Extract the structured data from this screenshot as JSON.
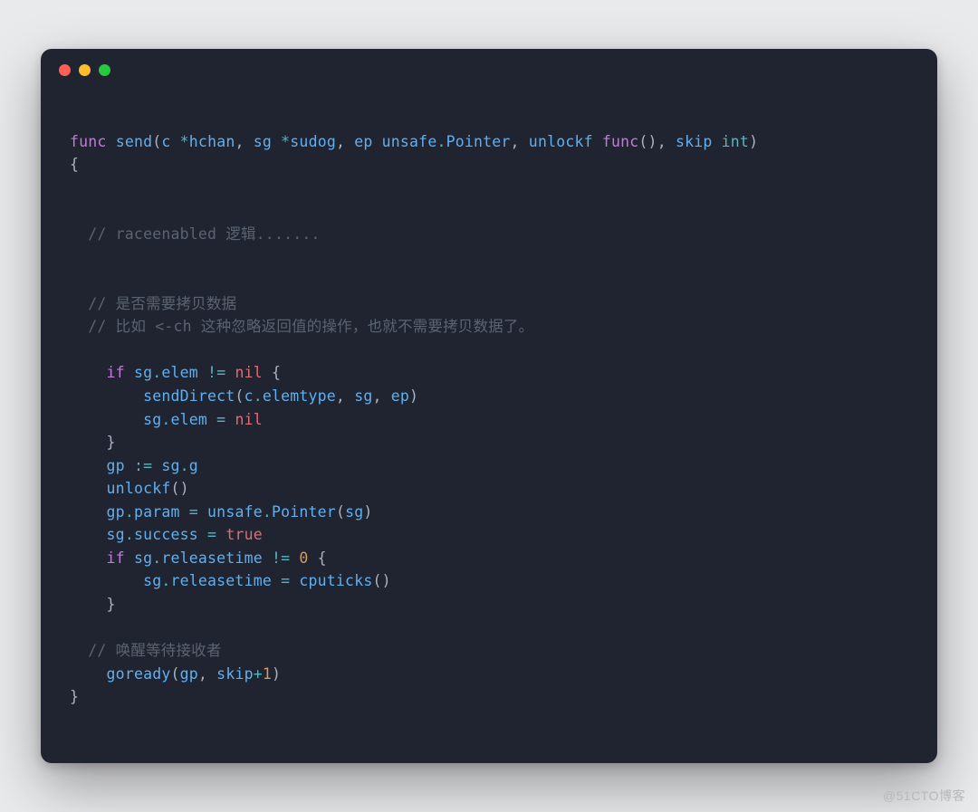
{
  "watermark": "@51CTO博客",
  "code": {
    "l1": {
      "kw1": "func",
      "fn": "send",
      "p1": "(",
      "id1": "c",
      "op1": " *",
      "id2": "hchan",
      "p2": ",",
      "id3": " sg",
      "op2": " *",
      "id4": "sudog",
      "p3": ",",
      "id5": " ep",
      "id6": " unsafe",
      "op3": ".",
      "id7": "Pointer",
      "p4": ",",
      "id8": " unlockf",
      "kw2": " func",
      "p5": "()",
      "p6": ",",
      "id9": " skip",
      "ty1": " int",
      "p7": ") "
    },
    "l2": {
      "p": "{"
    },
    "l3": {
      "txt": "  // raceenabled 逻辑......."
    },
    "l4": {
      "txt": "  // 是否需要拷贝数据"
    },
    "l5": {
      "txt": "  // 比如 <-ch 这种忽略返回值的操作，也就不需要拷贝数据了。"
    },
    "l6": {
      "kw": "if",
      "id1": " sg",
      "op1": ".",
      "id2": "elem",
      "op2": " != ",
      "nil": "nil",
      "p": " {"
    },
    "l7": {
      "fn": "sendDirect",
      "p1": "(",
      "id1": "c",
      "op1": ".",
      "id2": "elemtype",
      "p2": ",",
      "id3": " sg",
      "p3": ",",
      "id4": " ep",
      "p4": ")"
    },
    "l8": {
      "id1": "sg",
      "op1": ".",
      "id2": "elem",
      "op2": " = ",
      "nil": "nil"
    },
    "l9": {
      "p": "}"
    },
    "l10": {
      "id1": "gp",
      "op1": " := ",
      "id2": "sg",
      "op2": ".",
      "id3": "g"
    },
    "l11": {
      "fn": "unlockf",
      "p": "()"
    },
    "l12": {
      "id1": "gp",
      "op1": ".",
      "id2": "param",
      "op2": " = ",
      "id3": "unsafe",
      "op3": ".",
      "fn": "Pointer",
      "p1": "(",
      "id4": "sg",
      "p2": ")"
    },
    "l13": {
      "id1": "sg",
      "op1": ".",
      "id2": "success",
      "op2": " = ",
      "bool": "true"
    },
    "l14": {
      "kw": "if",
      "id1": " sg",
      "op1": ".",
      "id2": "releasetime",
      "op2": " != ",
      "num": "0",
      "p": " {"
    },
    "l15": {
      "id1": "sg",
      "op1": ".",
      "id2": "releasetime",
      "op2": " = ",
      "fn": "cputicks",
      "p": "()"
    },
    "l16": {
      "p": "}"
    },
    "l17": {
      "txt": "  // 唤醒等待接收者"
    },
    "l18": {
      "fn": "goready",
      "p1": "(",
      "id1": "gp",
      "p2": ",",
      "id2": " skip",
      "op1": "+",
      "num": "1",
      "p3": ")"
    },
    "l19": {
      "p": "}"
    }
  }
}
